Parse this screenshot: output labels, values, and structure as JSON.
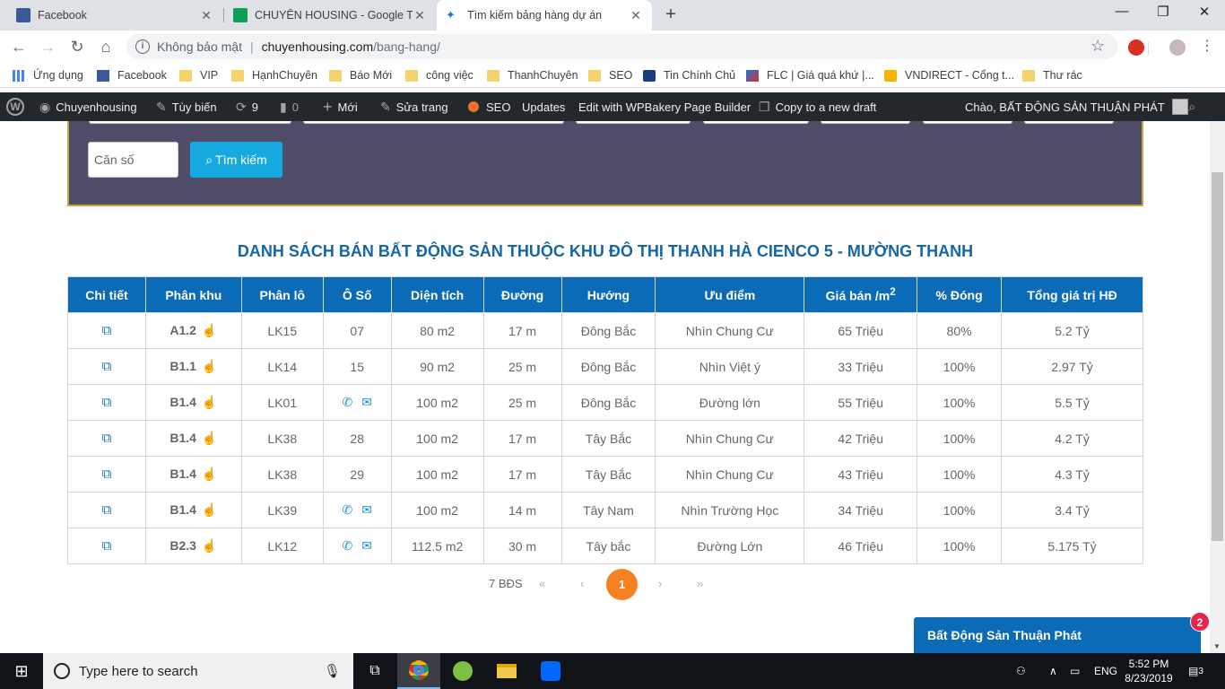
{
  "browser": {
    "tabs": [
      {
        "title": "Facebook",
        "favicon_color": "#3b5998"
      },
      {
        "title": "CHUYÊN HOUSING - Google Trang tính",
        "favicon_color": "#0f9d58"
      },
      {
        "title": "Tìm kiếm bảng hàng dự án",
        "favicon_color": "#1a73e8"
      }
    ],
    "new_tab": "+",
    "address": {
      "security": "Không bảo mật",
      "host": "chuyenhousing.com",
      "path": "/bang-hang/"
    },
    "bookmarks": [
      "Ứng dụng",
      "Facebook",
      "VIP",
      "HạnhChuyên",
      "Báo Mới",
      "công việc",
      "ThanhChuyên",
      "SEO",
      "Tin Chính Chủ",
      "FLC | Giá quá khứ |...",
      "VNDIRECT - Cổng t...",
      "Thư rác"
    ]
  },
  "admin_bar": {
    "site": "Chuyenhousing",
    "customize": "Tùy biến",
    "updates_count": "9",
    "comments_count": "0",
    "new": "Mới",
    "edit_page": "Sửa trang",
    "seo": "SEO",
    "updates": "Updates",
    "wpbakery": "Edit with WPBakery Page Builder",
    "copy_draft": "Copy to a new draft",
    "greeting": "Chào, BẤT ĐỘNG SẢN THUẬN PHÁT"
  },
  "search": {
    "placeholder": "Căn số",
    "button": "Tìm kiếm"
  },
  "listing": {
    "title": "DANH SÁCH BÁN BẤT ĐỘNG SẢN THUỘC KHU ĐÔ THỊ THANH HÀ CIENCO 5 - MƯỜNG THANH",
    "columns": {
      "detail": "Chi tiết",
      "zone": "Phân khu",
      "lot": "Phân lô",
      "unit": "Ô Số",
      "area": "Diện tích",
      "road": "Đường",
      "direction": "Hướng",
      "advantage": "Ưu điểm",
      "price_prefix": "Giá bán /m",
      "price_sup": "2",
      "paid": "% Đóng",
      "total": "Tổng giá trị HĐ"
    },
    "rows": [
      {
        "zone": "A1.2",
        "lot": "LK15",
        "unit": "07",
        "area": "80 m2",
        "road": "17 m",
        "direction": "Đông Bắc",
        "advantage": "Nhìn Chung Cư",
        "price": "65 Triệu",
        "paid": "80%",
        "total": "5.2 Tỷ"
      },
      {
        "zone": "B1.1",
        "lot": "LK14",
        "unit": "15",
        "area": "90 m2",
        "road": "25 m",
        "direction": "Đông Bắc",
        "advantage": "Nhìn Việt ý",
        "price": "33 Triệu",
        "paid": "100%",
        "total": "2.97 Tỷ"
      },
      {
        "zone": "B1.4",
        "lot": "LK01",
        "unit": "",
        "area": "100 m2",
        "road": "25 m",
        "direction": "Đông Bắc",
        "advantage": "Đường lớn",
        "price": "55 Triệu",
        "paid": "100%",
        "total": "5.5 Tỷ"
      },
      {
        "zone": "B1.4",
        "lot": "LK38",
        "unit": "28",
        "area": "100 m2",
        "road": "17 m",
        "direction": "Tây Bắc",
        "advantage": "Nhìn Chung Cư",
        "price": "42 Triệu",
        "paid": "100%",
        "total": "4.2 Tỷ"
      },
      {
        "zone": "B1.4",
        "lot": "LK38",
        "unit": "29",
        "area": "100 m2",
        "road": "17 m",
        "direction": "Tây Bắc",
        "advantage": "Nhìn Chung Cư",
        "price": "43 Triệu",
        "paid": "100%",
        "total": "4.3 Tỷ"
      },
      {
        "zone": "B1.4",
        "lot": "LK39",
        "unit": "",
        "area": "100 m2",
        "road": "14 m",
        "direction": "Tây Nam",
        "advantage": "Nhìn Trường Học",
        "price": "34 Triệu",
        "paid": "100%",
        "total": "3.4 Tỷ"
      },
      {
        "zone": "B2.3",
        "lot": "LK12",
        "unit": "",
        "area": "112.5 m2",
        "road": "30 m",
        "direction": "Tây bắc",
        "advantage": "Đường Lớn",
        "price": "46 Triệu",
        "paid": "100%",
        "total": "5.175 Tỷ"
      }
    ],
    "icons": {
      "detail": "external-link-icon",
      "zone_hand": "pointing-hand-icon",
      "phone": "phone-icon",
      "mail": "envelope-icon"
    }
  },
  "pagination": {
    "count": "7 BĐS",
    "first": "«",
    "prev": "‹",
    "current": "1",
    "next": "›",
    "last": "»"
  },
  "chat": {
    "title": "Bất Động Sản Thuận Phát",
    "badge": "2"
  },
  "taskbar": {
    "search_placeholder": "Type here to search",
    "lang": "ENG",
    "time": "5:52 PM",
    "date": "8/23/2019",
    "notifications": "3"
  }
}
